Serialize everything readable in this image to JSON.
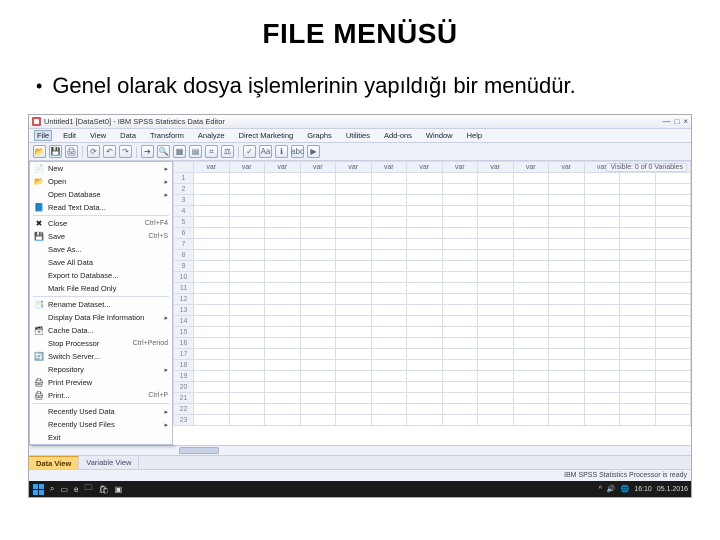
{
  "slide": {
    "title": "FILE MENÜSÜ",
    "bullet": "Genel olarak dosya işlemlerinin yapıldığı bir menüdür."
  },
  "titlebar": {
    "text": "Untitled1 [DataSet0] - IBM SPSS Statistics Data Editor",
    "min": "—",
    "max": "□",
    "close": "×"
  },
  "menubar": [
    "File",
    "Edit",
    "View",
    "Data",
    "Transform",
    "Analyze",
    "Direct Marketing",
    "Graphs",
    "Utilities",
    "Add-ons",
    "Window",
    "Help"
  ],
  "toolbar_icons": [
    "open-icon",
    "save-icon",
    "print-icon",
    "recall-icon",
    "undo-icon",
    "redo-icon",
    "goto-icon",
    "find-icon",
    "insert-var-icon",
    "insert-case-icon",
    "split-icon",
    "weight-icon",
    "select-icon",
    "value-labels-icon",
    "variables-icon",
    "spellcheck-icon",
    "run-icon"
  ],
  "toolbar_glyphs": [
    "📂",
    "💾",
    "🖨",
    "⟳",
    "↶",
    "↷",
    "➜",
    "🔍",
    "▦",
    "▤",
    "⌗",
    "⚖",
    "✓",
    "Aa",
    "ℹ",
    "abc",
    "▶"
  ],
  "dropdown": [
    {
      "icon": "📄",
      "label": "New",
      "arrow": "▸"
    },
    {
      "icon": "📂",
      "label": "Open",
      "arrow": "▸"
    },
    {
      "icon": "",
      "label": "Open Database",
      "arrow": "▸"
    },
    {
      "icon": "📘",
      "label": "Read Text Data...",
      "arrow": ""
    },
    {
      "sep": true
    },
    {
      "icon": "✖",
      "label": "Close",
      "short": "Ctrl+F4"
    },
    {
      "icon": "💾",
      "label": "Save",
      "short": "Ctrl+S"
    },
    {
      "icon": "",
      "label": "Save As..."
    },
    {
      "icon": "",
      "label": "Save All Data"
    },
    {
      "icon": "",
      "label": "Export to Database..."
    },
    {
      "icon": "",
      "label": "Mark File Read Only"
    },
    {
      "sep": true
    },
    {
      "icon": "📑",
      "label": "Rename Dataset..."
    },
    {
      "icon": "",
      "label": "Display Data File Information",
      "arrow": "▸"
    },
    {
      "icon": "🗃",
      "label": "Cache Data..."
    },
    {
      "icon": "",
      "label": "Stop Processor",
      "short": "Ctrl+Period"
    },
    {
      "icon": "🔄",
      "label": "Switch Server..."
    },
    {
      "icon": "",
      "label": "Repository",
      "arrow": "▸"
    },
    {
      "icon": "🖨",
      "label": "Print Preview"
    },
    {
      "icon": "🖨",
      "label": "Print...",
      "short": "Ctrl+P"
    },
    {
      "sep": true
    },
    {
      "icon": "",
      "label": "Recently Used Data",
      "arrow": "▸"
    },
    {
      "icon": "",
      "label": "Recently Used Files",
      "arrow": "▸"
    },
    {
      "icon": "",
      "label": "Exit"
    }
  ],
  "grid": {
    "hint": "Visible: 0 of 0 Variables",
    "col_label": "var",
    "cols": 14,
    "rows_start": 1,
    "rows_end": 23
  },
  "tabs": {
    "active": "Data View",
    "inactive": "Variable View"
  },
  "status": "IBM SPSS Statistics Processor is ready",
  "taskbar": {
    "time": "16:10",
    "date": "05.1.2016",
    "tray": [
      "^",
      "🔊",
      "🌐"
    ]
  }
}
